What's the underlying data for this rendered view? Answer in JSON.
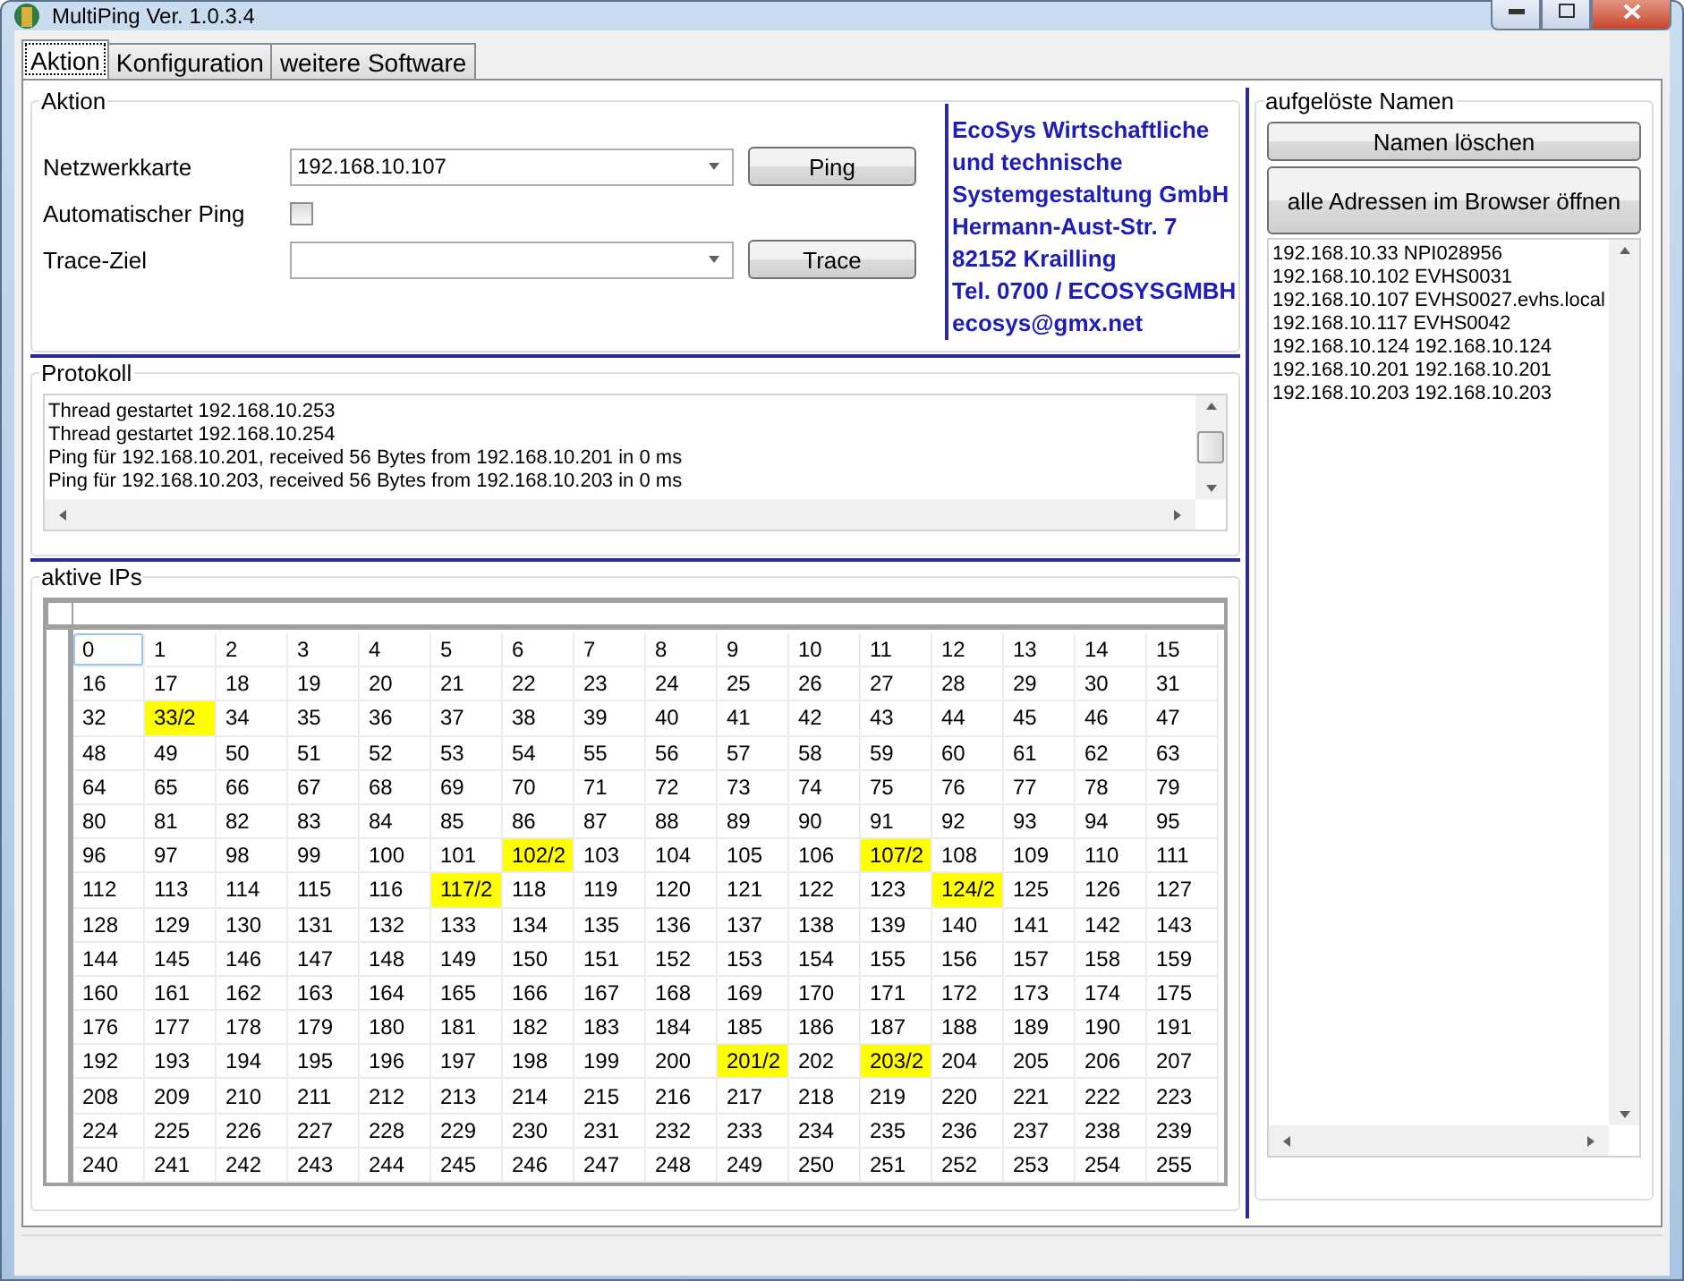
{
  "window": {
    "title": "MultiPing Ver. 1.0.3.4"
  },
  "tabs": [
    {
      "label": "Aktion",
      "selected": true
    },
    {
      "label": "Konfiguration",
      "selected": false
    },
    {
      "label": "weitere Software",
      "selected": false
    }
  ],
  "aktion": {
    "title": "Aktion",
    "netzwerkkarte": {
      "label": "Netzwerkkarte",
      "value": "192.168.10.107",
      "button": "Ping"
    },
    "auto_ping": {
      "label": "Automatischer Ping",
      "checked": false
    },
    "trace": {
      "label": "Trace-Ziel",
      "button": "Trace"
    },
    "company_lines": [
      "EcoSys Wirtschaftliche",
      "und technische",
      "Systemgestaltung GmbH",
      "Hermann-Aust-Str. 7",
      "82152 Krailling",
      "Tel. 0700 / ECOSYSGMBH",
      "ecosys@gmx.net"
    ]
  },
  "protokoll": {
    "title": "Protokoll",
    "lines": [
      "Thread gestartet 192.168.10.253",
      "Thread gestartet 192.168.10.254",
      "Ping für 192.168.10.201, received 56 Bytes from 192.168.10.201 in 0 ms",
      "Ping für 192.168.10.203, received 56 Bytes from 192.168.10.203 in 0 ms"
    ]
  },
  "aktive_ips": {
    "title": "aktive IPs",
    "rows": [
      [
        {
          "label": "0",
          "active": false,
          "selected": true
        },
        {
          "label": "1",
          "active": false,
          "selected": false
        },
        {
          "label": "2",
          "active": false,
          "selected": false
        },
        {
          "label": "3",
          "active": false,
          "selected": false
        },
        {
          "label": "4",
          "active": false,
          "selected": false
        },
        {
          "label": "5",
          "active": false,
          "selected": false
        },
        {
          "label": "6",
          "active": false,
          "selected": false
        },
        {
          "label": "7",
          "active": false,
          "selected": false
        },
        {
          "label": "8",
          "active": false,
          "selected": false
        },
        {
          "label": "9",
          "active": false,
          "selected": false
        },
        {
          "label": "10",
          "active": false,
          "selected": false
        },
        {
          "label": "11",
          "active": false,
          "selected": false
        },
        {
          "label": "12",
          "active": false,
          "selected": false
        },
        {
          "label": "13",
          "active": false,
          "selected": false
        },
        {
          "label": "14",
          "active": false,
          "selected": false
        },
        {
          "label": "15",
          "active": false,
          "selected": false
        }
      ],
      [
        {
          "label": "16",
          "active": false,
          "selected": false
        },
        {
          "label": "17",
          "active": false,
          "selected": false
        },
        {
          "label": "18",
          "active": false,
          "selected": false
        },
        {
          "label": "19",
          "active": false,
          "selected": false
        },
        {
          "label": "20",
          "active": false,
          "selected": false
        },
        {
          "label": "21",
          "active": false,
          "selected": false
        },
        {
          "label": "22",
          "active": false,
          "selected": false
        },
        {
          "label": "23",
          "active": false,
          "selected": false
        },
        {
          "label": "24",
          "active": false,
          "selected": false
        },
        {
          "label": "25",
          "active": false,
          "selected": false
        },
        {
          "label": "26",
          "active": false,
          "selected": false
        },
        {
          "label": "27",
          "active": false,
          "selected": false
        },
        {
          "label": "28",
          "active": false,
          "selected": false
        },
        {
          "label": "29",
          "active": false,
          "selected": false
        },
        {
          "label": "30",
          "active": false,
          "selected": false
        },
        {
          "label": "31",
          "active": false,
          "selected": false
        }
      ],
      [
        {
          "label": "32",
          "active": false,
          "selected": false
        },
        {
          "label": "33/2",
          "active": true,
          "selected": false
        },
        {
          "label": "34",
          "active": false,
          "selected": false
        },
        {
          "label": "35",
          "active": false,
          "selected": false
        },
        {
          "label": "36",
          "active": false,
          "selected": false
        },
        {
          "label": "37",
          "active": false,
          "selected": false
        },
        {
          "label": "38",
          "active": false,
          "selected": false
        },
        {
          "label": "39",
          "active": false,
          "selected": false
        },
        {
          "label": "40",
          "active": false,
          "selected": false
        },
        {
          "label": "41",
          "active": false,
          "selected": false
        },
        {
          "label": "42",
          "active": false,
          "selected": false
        },
        {
          "label": "43",
          "active": false,
          "selected": false
        },
        {
          "label": "44",
          "active": false,
          "selected": false
        },
        {
          "label": "45",
          "active": false,
          "selected": false
        },
        {
          "label": "46",
          "active": false,
          "selected": false
        },
        {
          "label": "47",
          "active": false,
          "selected": false
        }
      ],
      [
        {
          "label": "48",
          "active": false,
          "selected": false
        },
        {
          "label": "49",
          "active": false,
          "selected": false
        },
        {
          "label": "50",
          "active": false,
          "selected": false
        },
        {
          "label": "51",
          "active": false,
          "selected": false
        },
        {
          "label": "52",
          "active": false,
          "selected": false
        },
        {
          "label": "53",
          "active": false,
          "selected": false
        },
        {
          "label": "54",
          "active": false,
          "selected": false
        },
        {
          "label": "55",
          "active": false,
          "selected": false
        },
        {
          "label": "56",
          "active": false,
          "selected": false
        },
        {
          "label": "57",
          "active": false,
          "selected": false
        },
        {
          "label": "58",
          "active": false,
          "selected": false
        },
        {
          "label": "59",
          "active": false,
          "selected": false
        },
        {
          "label": "60",
          "active": false,
          "selected": false
        },
        {
          "label": "61",
          "active": false,
          "selected": false
        },
        {
          "label": "62",
          "active": false,
          "selected": false
        },
        {
          "label": "63",
          "active": false,
          "selected": false
        }
      ],
      [
        {
          "label": "64",
          "active": false,
          "selected": false
        },
        {
          "label": "65",
          "active": false,
          "selected": false
        },
        {
          "label": "66",
          "active": false,
          "selected": false
        },
        {
          "label": "67",
          "active": false,
          "selected": false
        },
        {
          "label": "68",
          "active": false,
          "selected": false
        },
        {
          "label": "69",
          "active": false,
          "selected": false
        },
        {
          "label": "70",
          "active": false,
          "selected": false
        },
        {
          "label": "71",
          "active": false,
          "selected": false
        },
        {
          "label": "72",
          "active": false,
          "selected": false
        },
        {
          "label": "73",
          "active": false,
          "selected": false
        },
        {
          "label": "74",
          "active": false,
          "selected": false
        },
        {
          "label": "75",
          "active": false,
          "selected": false
        },
        {
          "label": "76",
          "active": false,
          "selected": false
        },
        {
          "label": "77",
          "active": false,
          "selected": false
        },
        {
          "label": "78",
          "active": false,
          "selected": false
        },
        {
          "label": "79",
          "active": false,
          "selected": false
        }
      ],
      [
        {
          "label": "80",
          "active": false,
          "selected": false
        },
        {
          "label": "81",
          "active": false,
          "selected": false
        },
        {
          "label": "82",
          "active": false,
          "selected": false
        },
        {
          "label": "83",
          "active": false,
          "selected": false
        },
        {
          "label": "84",
          "active": false,
          "selected": false
        },
        {
          "label": "85",
          "active": false,
          "selected": false
        },
        {
          "label": "86",
          "active": false,
          "selected": false
        },
        {
          "label": "87",
          "active": false,
          "selected": false
        },
        {
          "label": "88",
          "active": false,
          "selected": false
        },
        {
          "label": "89",
          "active": false,
          "selected": false
        },
        {
          "label": "90",
          "active": false,
          "selected": false
        },
        {
          "label": "91",
          "active": false,
          "selected": false
        },
        {
          "label": "92",
          "active": false,
          "selected": false
        },
        {
          "label": "93",
          "active": false,
          "selected": false
        },
        {
          "label": "94",
          "active": false,
          "selected": false
        },
        {
          "label": "95",
          "active": false,
          "selected": false
        }
      ],
      [
        {
          "label": "96",
          "active": false,
          "selected": false
        },
        {
          "label": "97",
          "active": false,
          "selected": false
        },
        {
          "label": "98",
          "active": false,
          "selected": false
        },
        {
          "label": "99",
          "active": false,
          "selected": false
        },
        {
          "label": "100",
          "active": false,
          "selected": false
        },
        {
          "label": "101",
          "active": false,
          "selected": false
        },
        {
          "label": "102/2",
          "active": true,
          "selected": false
        },
        {
          "label": "103",
          "active": false,
          "selected": false
        },
        {
          "label": "104",
          "active": false,
          "selected": false
        },
        {
          "label": "105",
          "active": false,
          "selected": false
        },
        {
          "label": "106",
          "active": false,
          "selected": false
        },
        {
          "label": "107/2",
          "active": true,
          "selected": false
        },
        {
          "label": "108",
          "active": false,
          "selected": false
        },
        {
          "label": "109",
          "active": false,
          "selected": false
        },
        {
          "label": "110",
          "active": false,
          "selected": false
        },
        {
          "label": "111",
          "active": false,
          "selected": false
        }
      ],
      [
        {
          "label": "112",
          "active": false,
          "selected": false
        },
        {
          "label": "113",
          "active": false,
          "selected": false
        },
        {
          "label": "114",
          "active": false,
          "selected": false
        },
        {
          "label": "115",
          "active": false,
          "selected": false
        },
        {
          "label": "116",
          "active": false,
          "selected": false
        },
        {
          "label": "117/2",
          "active": true,
          "selected": false
        },
        {
          "label": "118",
          "active": false,
          "selected": false
        },
        {
          "label": "119",
          "active": false,
          "selected": false
        },
        {
          "label": "120",
          "active": false,
          "selected": false
        },
        {
          "label": "121",
          "active": false,
          "selected": false
        },
        {
          "label": "122",
          "active": false,
          "selected": false
        },
        {
          "label": "123",
          "active": false,
          "selected": false
        },
        {
          "label": "124/2",
          "active": true,
          "selected": false
        },
        {
          "label": "125",
          "active": false,
          "selected": false
        },
        {
          "label": "126",
          "active": false,
          "selected": false
        },
        {
          "label": "127",
          "active": false,
          "selected": false
        }
      ],
      [
        {
          "label": "128",
          "active": false,
          "selected": false
        },
        {
          "label": "129",
          "active": false,
          "selected": false
        },
        {
          "label": "130",
          "active": false,
          "selected": false
        },
        {
          "label": "131",
          "active": false,
          "selected": false
        },
        {
          "label": "132",
          "active": false,
          "selected": false
        },
        {
          "label": "133",
          "active": false,
          "selected": false
        },
        {
          "label": "134",
          "active": false,
          "selected": false
        },
        {
          "label": "135",
          "active": false,
          "selected": false
        },
        {
          "label": "136",
          "active": false,
          "selected": false
        },
        {
          "label": "137",
          "active": false,
          "selected": false
        },
        {
          "label": "138",
          "active": false,
          "selected": false
        },
        {
          "label": "139",
          "active": false,
          "selected": false
        },
        {
          "label": "140",
          "active": false,
          "selected": false
        },
        {
          "label": "141",
          "active": false,
          "selected": false
        },
        {
          "label": "142",
          "active": false,
          "selected": false
        },
        {
          "label": "143",
          "active": false,
          "selected": false
        }
      ],
      [
        {
          "label": "144",
          "active": false,
          "selected": false
        },
        {
          "label": "145",
          "active": false,
          "selected": false
        },
        {
          "label": "146",
          "active": false,
          "selected": false
        },
        {
          "label": "147",
          "active": false,
          "selected": false
        },
        {
          "label": "148",
          "active": false,
          "selected": false
        },
        {
          "label": "149",
          "active": false,
          "selected": false
        },
        {
          "label": "150",
          "active": false,
          "selected": false
        },
        {
          "label": "151",
          "active": false,
          "selected": false
        },
        {
          "label": "152",
          "active": false,
          "selected": false
        },
        {
          "label": "153",
          "active": false,
          "selected": false
        },
        {
          "label": "154",
          "active": false,
          "selected": false
        },
        {
          "label": "155",
          "active": false,
          "selected": false
        },
        {
          "label": "156",
          "active": false,
          "selected": false
        },
        {
          "label": "157",
          "active": false,
          "selected": false
        },
        {
          "label": "158",
          "active": false,
          "selected": false
        },
        {
          "label": "159",
          "active": false,
          "selected": false
        }
      ],
      [
        {
          "label": "160",
          "active": false,
          "selected": false
        },
        {
          "label": "161",
          "active": false,
          "selected": false
        },
        {
          "label": "162",
          "active": false,
          "selected": false
        },
        {
          "label": "163",
          "active": false,
          "selected": false
        },
        {
          "label": "164",
          "active": false,
          "selected": false
        },
        {
          "label": "165",
          "active": false,
          "selected": false
        },
        {
          "label": "166",
          "active": false,
          "selected": false
        },
        {
          "label": "167",
          "active": false,
          "selected": false
        },
        {
          "label": "168",
          "active": false,
          "selected": false
        },
        {
          "label": "169",
          "active": false,
          "selected": false
        },
        {
          "label": "170",
          "active": false,
          "selected": false
        },
        {
          "label": "171",
          "active": false,
          "selected": false
        },
        {
          "label": "172",
          "active": false,
          "selected": false
        },
        {
          "label": "173",
          "active": false,
          "selected": false
        },
        {
          "label": "174",
          "active": false,
          "selected": false
        },
        {
          "label": "175",
          "active": false,
          "selected": false
        }
      ],
      [
        {
          "label": "176",
          "active": false,
          "selected": false
        },
        {
          "label": "177",
          "active": false,
          "selected": false
        },
        {
          "label": "178",
          "active": false,
          "selected": false
        },
        {
          "label": "179",
          "active": false,
          "selected": false
        },
        {
          "label": "180",
          "active": false,
          "selected": false
        },
        {
          "label": "181",
          "active": false,
          "selected": false
        },
        {
          "label": "182",
          "active": false,
          "selected": false
        },
        {
          "label": "183",
          "active": false,
          "selected": false
        },
        {
          "label": "184",
          "active": false,
          "selected": false
        },
        {
          "label": "185",
          "active": false,
          "selected": false
        },
        {
          "label": "186",
          "active": false,
          "selected": false
        },
        {
          "label": "187",
          "active": false,
          "selected": false
        },
        {
          "label": "188",
          "active": false,
          "selected": false
        },
        {
          "label": "189",
          "active": false,
          "selected": false
        },
        {
          "label": "190",
          "active": false,
          "selected": false
        },
        {
          "label": "191",
          "active": false,
          "selected": false
        }
      ],
      [
        {
          "label": "192",
          "active": false,
          "selected": false
        },
        {
          "label": "193",
          "active": false,
          "selected": false
        },
        {
          "label": "194",
          "active": false,
          "selected": false
        },
        {
          "label": "195",
          "active": false,
          "selected": false
        },
        {
          "label": "196",
          "active": false,
          "selected": false
        },
        {
          "label": "197",
          "active": false,
          "selected": false
        },
        {
          "label": "198",
          "active": false,
          "selected": false
        },
        {
          "label": "199",
          "active": false,
          "selected": false
        },
        {
          "label": "200",
          "active": false,
          "selected": false
        },
        {
          "label": "201/2",
          "active": true,
          "selected": false
        },
        {
          "label": "202",
          "active": false,
          "selected": false
        },
        {
          "label": "203/2",
          "active": true,
          "selected": false
        },
        {
          "label": "204",
          "active": false,
          "selected": false
        },
        {
          "label": "205",
          "active": false,
          "selected": false
        },
        {
          "label": "206",
          "active": false,
          "selected": false
        },
        {
          "label": "207",
          "active": false,
          "selected": false
        }
      ],
      [
        {
          "label": "208",
          "active": false,
          "selected": false
        },
        {
          "label": "209",
          "active": false,
          "selected": false
        },
        {
          "label": "210",
          "active": false,
          "selected": false
        },
        {
          "label": "211",
          "active": false,
          "selected": false
        },
        {
          "label": "212",
          "active": false,
          "selected": false
        },
        {
          "label": "213",
          "active": false,
          "selected": false
        },
        {
          "label": "214",
          "active": false,
          "selected": false
        },
        {
          "label": "215",
          "active": false,
          "selected": false
        },
        {
          "label": "216",
          "active": false,
          "selected": false
        },
        {
          "label": "217",
          "active": false,
          "selected": false
        },
        {
          "label": "218",
          "active": false,
          "selected": false
        },
        {
          "label": "219",
          "active": false,
          "selected": false
        },
        {
          "label": "220",
          "active": false,
          "selected": false
        },
        {
          "label": "221",
          "active": false,
          "selected": false
        },
        {
          "label": "222",
          "active": false,
          "selected": false
        },
        {
          "label": "223",
          "active": false,
          "selected": false
        }
      ],
      [
        {
          "label": "224",
          "active": false,
          "selected": false
        },
        {
          "label": "225",
          "active": false,
          "selected": false
        },
        {
          "label": "226",
          "active": false,
          "selected": false
        },
        {
          "label": "227",
          "active": false,
          "selected": false
        },
        {
          "label": "228",
          "active": false,
          "selected": false
        },
        {
          "label": "229",
          "active": false,
          "selected": false
        },
        {
          "label": "230",
          "active": false,
          "selected": false
        },
        {
          "label": "231",
          "active": false,
          "selected": false
        },
        {
          "label": "232",
          "active": false,
          "selected": false
        },
        {
          "label": "233",
          "active": false,
          "selected": false
        },
        {
          "label": "234",
          "active": false,
          "selected": false
        },
        {
          "label": "235",
          "active": false,
          "selected": false
        },
        {
          "label": "236",
          "active": false,
          "selected": false
        },
        {
          "label": "237",
          "active": false,
          "selected": false
        },
        {
          "label": "238",
          "active": false,
          "selected": false
        },
        {
          "label": "239",
          "active": false,
          "selected": false
        }
      ],
      [
        {
          "label": "240",
          "active": false,
          "selected": false
        },
        {
          "label": "241",
          "active": false,
          "selected": false
        },
        {
          "label": "242",
          "active": false,
          "selected": false
        },
        {
          "label": "243",
          "active": false,
          "selected": false
        },
        {
          "label": "244",
          "active": false,
          "selected": false
        },
        {
          "label": "245",
          "active": false,
          "selected": false
        },
        {
          "label": "246",
          "active": false,
          "selected": false
        },
        {
          "label": "247",
          "active": false,
          "selected": false
        },
        {
          "label": "248",
          "active": false,
          "selected": false
        },
        {
          "label": "249",
          "active": false,
          "selected": false
        },
        {
          "label": "250",
          "active": false,
          "selected": false
        },
        {
          "label": "251",
          "active": false,
          "selected": false
        },
        {
          "label": "252",
          "active": false,
          "selected": false
        },
        {
          "label": "253",
          "active": false,
          "selected": false
        },
        {
          "label": "254",
          "active": false,
          "selected": false
        },
        {
          "label": "255",
          "active": false,
          "selected": false
        }
      ]
    ]
  },
  "names": {
    "title": "aufgelöste Namen",
    "clear_button": "Namen löschen",
    "browser_button": "alle Adressen im Browser öffnen",
    "entries": [
      "192.168.10.33 NPI028956",
      "192.168.10.102 EVHS0031",
      "192.168.10.107 EVHS0027.evhs.local",
      "192.168.10.117 EVHS0042",
      "192.168.10.124 192.168.10.124",
      "192.168.10.201 192.168.10.201",
      "192.168.10.203 192.168.10.203"
    ]
  }
}
